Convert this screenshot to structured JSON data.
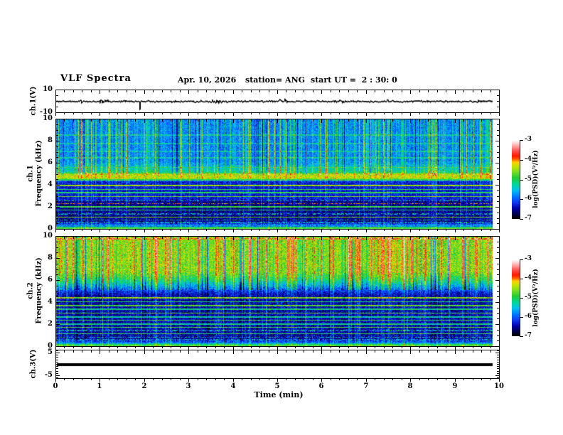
{
  "header": {
    "title": "VLF Spectra",
    "date": "Apr. 10, 2026",
    "station": "station= ANG",
    "start_ut": "start UT =  2 : 30: 0"
  },
  "axes": {
    "x": {
      "label": "Time (min)",
      "range": [
        0,
        10
      ],
      "ticks": [
        0,
        1,
        2,
        3,
        4,
        5,
        6,
        7,
        8,
        9,
        10
      ],
      "minor_step_min": 0.2
    }
  },
  "colormap": {
    "range": [
      -7,
      -3
    ],
    "stops": [
      [
        0.0,
        "#000000"
      ],
      [
        0.05,
        "#000044"
      ],
      [
        0.13,
        "#0000aa"
      ],
      [
        0.2,
        "#1133ee"
      ],
      [
        0.28,
        "#0077ff"
      ],
      [
        0.36,
        "#00c0ee"
      ],
      [
        0.44,
        "#00d89a"
      ],
      [
        0.52,
        "#22cc33"
      ],
      [
        0.6,
        "#7fdd22"
      ],
      [
        0.67,
        "#c8e400"
      ],
      [
        0.72,
        "#ffd000"
      ],
      [
        0.76,
        "#ff5500"
      ],
      [
        0.8,
        "#ff1a00"
      ],
      [
        0.87,
        "#ff5555"
      ],
      [
        0.93,
        "#ffaaaa"
      ],
      [
        0.97,
        "#ffdddd"
      ],
      [
        1.0,
        "#ffffff"
      ]
    ]
  },
  "chart_data": [
    {
      "type": "line",
      "id": "ch1_voltage_waveform",
      "ylabel": "ch.1(V)",
      "ylim": [
        -10,
        10
      ],
      "y_ticks": [
        10,
        -10
      ],
      "xlim_min": [
        0,
        10
      ],
      "data_end_min": 9.85,
      "baseline_v": 0,
      "noise_amplitude_v": 1.5,
      "spike": {
        "t_min": 1.88,
        "v": -7.5
      },
      "seed": 5
    },
    {
      "type": "heatmap",
      "id": "ch1_spectrogram",
      "ylabel_lines": [
        "ch.1",
        "Frequency (kHz)"
      ],
      "ylim": [
        0,
        10
      ],
      "y_ticks": [
        10,
        8,
        6,
        4,
        2,
        0
      ],
      "xlim_min": [
        0,
        10
      ],
      "data_end_min": 9.85,
      "colorbar": {
        "label": "log(PSD)(V²/Hz)",
        "ticks": [
          -3,
          -4,
          -5,
          -6,
          -7
        ],
        "range": [
          -7,
          -3
        ]
      },
      "profile": [
        [
          10,
          -5.85
        ],
        [
          6.2,
          -5.85
        ],
        [
          5.6,
          -5.5
        ],
        [
          5.15,
          -5.25
        ],
        [
          5.0,
          -4.45
        ],
        [
          4.6,
          -4.4
        ],
        [
          4.45,
          -5.6
        ],
        [
          4.3,
          -6.35
        ],
        [
          2.65,
          -6.35
        ],
        [
          2.5,
          -6.6
        ],
        [
          0.55,
          -6.6
        ],
        [
          0.4,
          -6.1
        ],
        [
          0.18,
          -5.9
        ],
        [
          0.12,
          -5.05
        ],
        [
          0,
          -4.85
        ]
      ],
      "bands": [
        [
          8.6,
          0.1,
          -5.35,
          0
        ],
        [
          7.8,
          0.1,
          -5.45,
          0
        ],
        [
          7.1,
          0.1,
          -5.45,
          0
        ],
        [
          6.5,
          0.1,
          -5.35,
          0
        ],
        [
          5.62,
          0.12,
          -5.0,
          0
        ],
        [
          4.45,
          0.1,
          -4.9,
          0
        ],
        [
          3.95,
          0.14,
          -4.55,
          0
        ],
        [
          3.6,
          0.1,
          -5.0,
          0
        ],
        [
          3.3,
          0.1,
          -5.1,
          0
        ],
        [
          2.95,
          0.1,
          -4.75,
          0
        ],
        [
          2.55,
          0.1,
          -5.3,
          1
        ],
        [
          2.3,
          0.1,
          -4.1,
          1
        ],
        [
          2.0,
          0.1,
          -4.95,
          0
        ],
        [
          1.7,
          0.1,
          -5.1,
          0
        ],
        [
          1.35,
          0.09,
          -5.4,
          1
        ],
        [
          1.05,
          0.1,
          -4.7,
          0
        ],
        [
          0.8,
          0.09,
          -5.3,
          1
        ],
        [
          0.55,
          0.09,
          -5.5,
          1
        ],
        [
          0.3,
          0.1,
          -5.6,
          1
        ]
      ],
      "streaks": {
        "density": 0.55,
        "pow": 2.2,
        "gain": 1.6,
        "strong_density": 0.04,
        "strong_gain": 0.5,
        "neg_density": 0.12,
        "neg_gain": 0.9,
        "fmin": 4.95,
        "below_factor": 0.3
      },
      "noise": 0.7,
      "seed": 12345
    },
    {
      "type": "heatmap",
      "id": "ch2_spectrogram",
      "ylabel_lines": [
        "ch.2",
        "Frequency (kHz)"
      ],
      "ylim": [
        0,
        10
      ],
      "y_ticks": [
        10,
        8,
        6,
        4,
        2,
        0
      ],
      "xlim_min": [
        0,
        10
      ],
      "data_end_min": 9.85,
      "colorbar": {
        "label": "log(PSD)(V²/Hz)",
        "ticks": [
          -3,
          -4,
          -5,
          -6,
          -7
        ],
        "range": [
          -7,
          -3
        ]
      },
      "profile": [
        [
          10,
          -4.6
        ],
        [
          6.8,
          -4.6
        ],
        [
          6.0,
          -5.15
        ],
        [
          5.3,
          -5.9
        ],
        [
          4.9,
          -6.3
        ],
        [
          4.65,
          -6.5
        ],
        [
          0.6,
          -6.5
        ],
        [
          0.45,
          -6.2
        ],
        [
          0.25,
          -5.9
        ],
        [
          0.15,
          -5.15
        ],
        [
          0,
          -4.8
        ]
      ],
      "bands": [
        [
          9.85,
          0.14,
          -4.0,
          0
        ],
        [
          4.4,
          0.13,
          -4.6,
          0
        ],
        [
          4.05,
          0.1,
          -5.1,
          0
        ],
        [
          3.7,
          0.1,
          -4.85,
          0
        ],
        [
          3.35,
          0.1,
          -5.2,
          0
        ],
        [
          3.0,
          0.1,
          -4.8,
          0
        ],
        [
          2.65,
          0.1,
          -5.3,
          0
        ],
        [
          2.35,
          0.1,
          -5.0,
          0
        ],
        [
          2.0,
          0.09,
          -5.25,
          0
        ],
        [
          1.7,
          0.09,
          -4.9,
          0
        ],
        [
          1.4,
          0.08,
          -5.4,
          1
        ],
        [
          1.1,
          0.09,
          -5.0,
          0
        ],
        [
          0.8,
          0.08,
          -5.35,
          1
        ],
        [
          0.55,
          0.08,
          -5.6,
          1
        ]
      ],
      "streaks": {
        "density": 0.5,
        "pow": 2.0,
        "gain": 1.15,
        "strong_density": 0.05,
        "strong_gain": 0.8,
        "neg_density": 0.16,
        "neg_gain": 1.6,
        "fmin": 5.1,
        "below_factor": 0.42
      },
      "noise": 0.8,
      "seed": 99
    },
    {
      "type": "line",
      "id": "ch3_voltage_waveform",
      "ylabel": "ch.3(V)",
      "ylim": [
        -6.25,
        6.25
      ],
      "y_ticks": [
        5,
        -5
      ],
      "xlim_min": [
        0,
        10
      ],
      "data_end_min": 9.85,
      "baseline_v": 0,
      "noise_amplitude_v": 0,
      "line_thickness_px": 4,
      "seed": 1
    }
  ]
}
